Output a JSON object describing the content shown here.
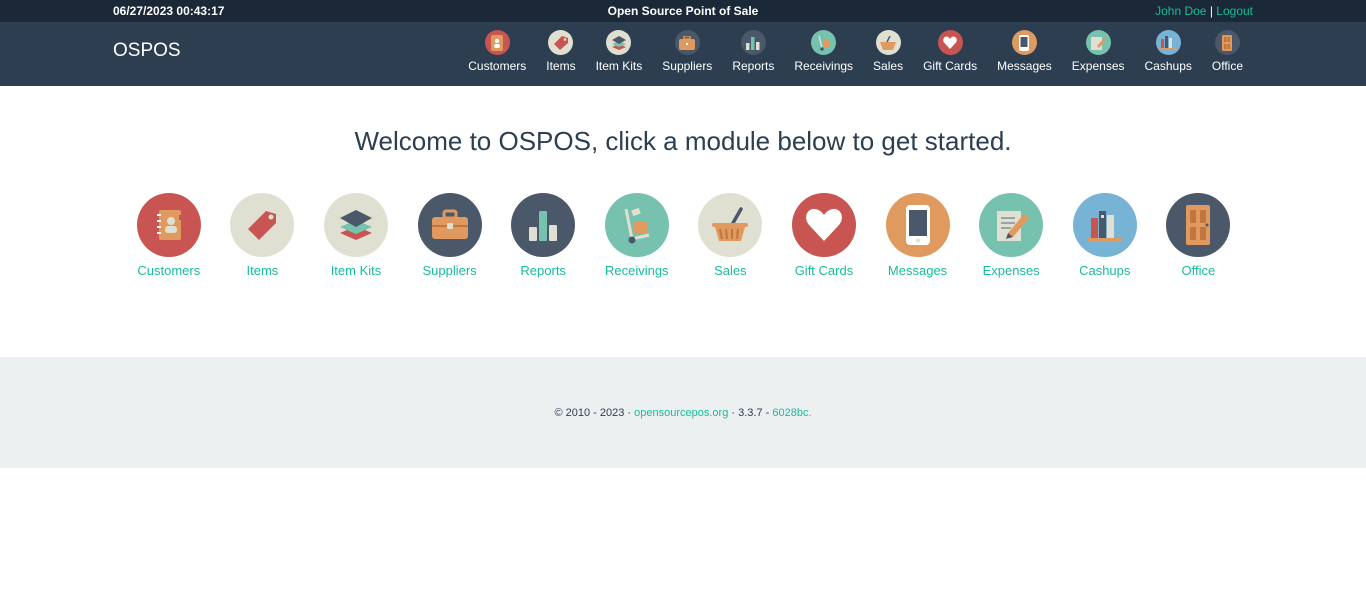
{
  "topbar": {
    "datetime": "06/27/2023 00:43:17",
    "title": "Open Source Point of Sale",
    "user": "John Doe",
    "separator": "|",
    "logout": "Logout"
  },
  "navbar": {
    "brand": "OSPOS",
    "items": [
      {
        "label": "Customers"
      },
      {
        "label": "Items"
      },
      {
        "label": "Item Kits"
      },
      {
        "label": "Suppliers"
      },
      {
        "label": "Reports"
      },
      {
        "label": "Receivings"
      },
      {
        "label": "Sales"
      },
      {
        "label": "Gift Cards"
      },
      {
        "label": "Messages"
      },
      {
        "label": "Expenses"
      },
      {
        "label": "Cashups"
      },
      {
        "label": "Office"
      }
    ]
  },
  "main": {
    "welcome": "Welcome to OSPOS, click a module below to get started.",
    "modules": [
      {
        "label": "Customers",
        "icon": "address-book-icon",
        "color": "#c95552"
      },
      {
        "label": "Items",
        "icon": "price-tag-icon",
        "color": "#e0e0d2"
      },
      {
        "label": "Item Kits",
        "icon": "stacked-layers-icon",
        "color": "#e0e0d2"
      },
      {
        "label": "Suppliers",
        "icon": "briefcase-icon",
        "color": "#4b5869"
      },
      {
        "label": "Reports",
        "icon": "bar-chart-icon",
        "color": "#4b5869"
      },
      {
        "label": "Receivings",
        "icon": "hand-truck-icon",
        "color": "#76c2af"
      },
      {
        "label": "Sales",
        "icon": "shopping-basket-icon",
        "color": "#e0e0d2"
      },
      {
        "label": "Gift Cards",
        "icon": "heart-icon",
        "color": "#c95552"
      },
      {
        "label": "Messages",
        "icon": "smartphone-icon",
        "color": "#e0995e"
      },
      {
        "label": "Expenses",
        "icon": "document-pencil-icon",
        "color": "#76c2af"
      },
      {
        "label": "Cashups",
        "icon": "books-icon",
        "color": "#77b3d4"
      },
      {
        "label": "Office",
        "icon": "door-icon",
        "color": "#4b5869"
      }
    ]
  },
  "footer": {
    "copyright": "© 2010 - 2023 ·",
    "site": "opensourcepos.org",
    "version": "· 3.3.7 -",
    "commit": "6028bc."
  }
}
